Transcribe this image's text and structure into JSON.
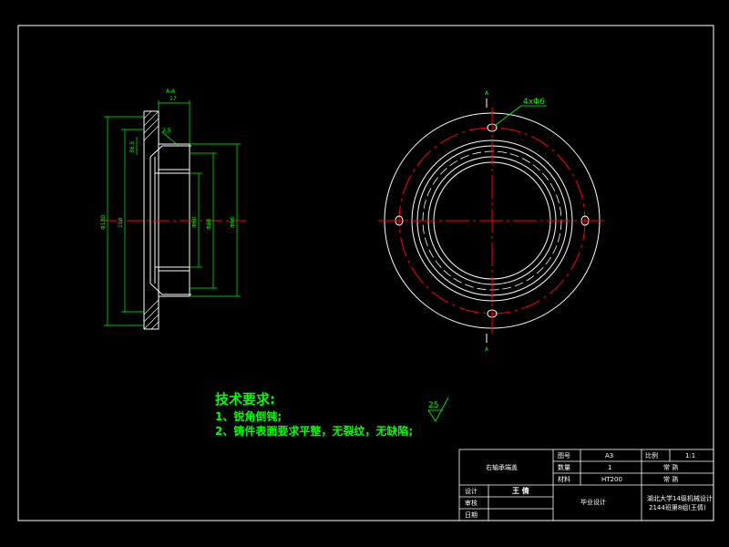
{
  "colors": {
    "background": "#000000",
    "frame": "#ffffff",
    "part_outline": "#ffffff",
    "dimension": "#00ff00",
    "centerline": "#ff0000",
    "text": "#00ff00"
  },
  "hole_callout": "4xΦ6",
  "section_marks": {
    "top": "A",
    "bottom": "A",
    "section_label": "A-A"
  },
  "dimension_labels": {
    "top_width": "17",
    "chamfer": "2.5",
    "small_step": "36.5",
    "outer_left": "Φ130",
    "mid_left": "108",
    "inner_bore": "Φ60",
    "inner_step": "Φ80",
    "outer_right": "Φ96"
  },
  "roughness_value": "25",
  "tech_requirements": {
    "title": "技术要求:",
    "items": [
      "1、锐角倒钝;",
      "2、铸件表面要求平整，无裂纹，无缺陷;"
    ]
  },
  "title_block": {
    "part_name": "右轴承端盖",
    "drawing_no_label": "图号",
    "drawing_no": "A3",
    "scale_label": "比例",
    "scale": "1:1",
    "quantity_label": "数量",
    "quantity": "1",
    "material_label": "材料",
    "material": "HT200",
    "note1": "常  熟",
    "note2": "常  熟",
    "designer_label": "设计",
    "designer": "王 倩",
    "checker_label": "审核",
    "date_label": "日期",
    "project": "毕业设计",
    "school": "湖北大学14级机械设计",
    "class_info": "2144班第8组(王倩)"
  }
}
